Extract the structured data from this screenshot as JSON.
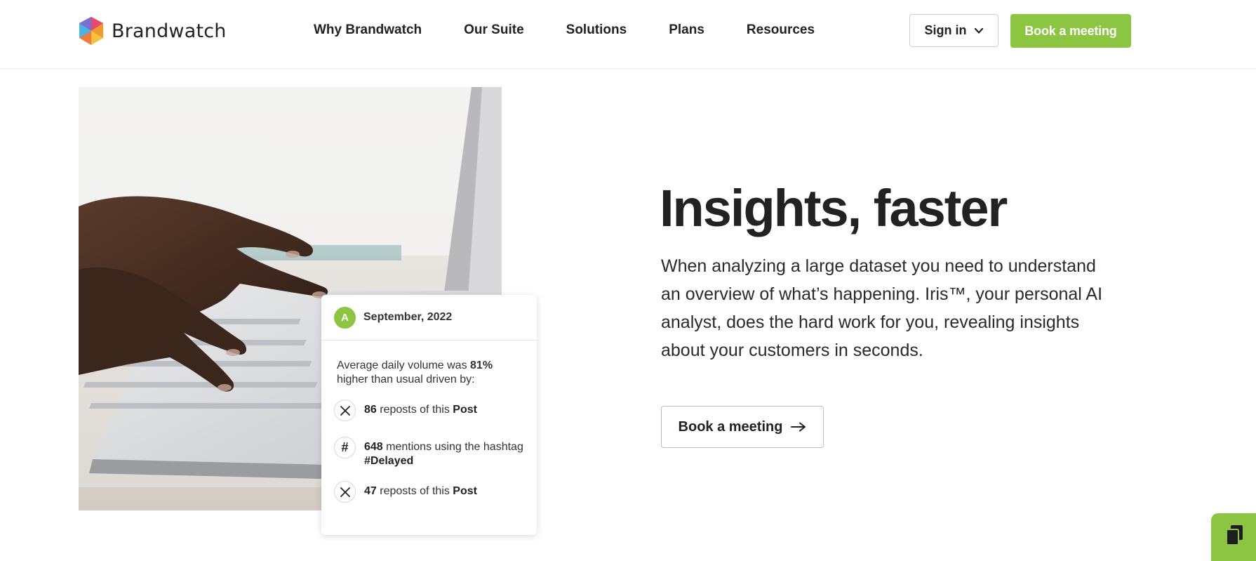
{
  "brand": {
    "name": "Brandwatch",
    "accent": "#8cc541"
  },
  "nav": {
    "items": [
      "Why Brandwatch",
      "Our Suite",
      "Solutions",
      "Plans",
      "Resources"
    ]
  },
  "header": {
    "signin_label": "Sign in",
    "book_label": "Book a meeting"
  },
  "hero": {
    "title": "Insights, faster",
    "body": "When analyzing a large dataset you need to understand an overview of what’s happening. Iris™, your personal AI analyst, does the hard work for you, revealing insights about your customers in seconds.",
    "cta_label": "Book a meeting",
    "image_alt_icon": "typing-hands-photo"
  },
  "card": {
    "avatar_letter": "A",
    "date": "September, 2022",
    "summary_pre": "Average daily volume was ",
    "summary_pct": "81%",
    "summary_post": " higher than usual driven by:",
    "rows": [
      {
        "icon": "x-logo-icon",
        "num": "86",
        "mid": " reposts of this ",
        "strong": "Post"
      },
      {
        "icon": "hashtag-icon",
        "num": "648",
        "mid": " mentions using the hashtag ",
        "strong": "#Delayed"
      },
      {
        "icon": "x-logo-icon",
        "num": "47",
        "mid": " reposts of this ",
        "strong": "Post"
      }
    ]
  },
  "widget": {
    "icon": "documents-icon"
  }
}
